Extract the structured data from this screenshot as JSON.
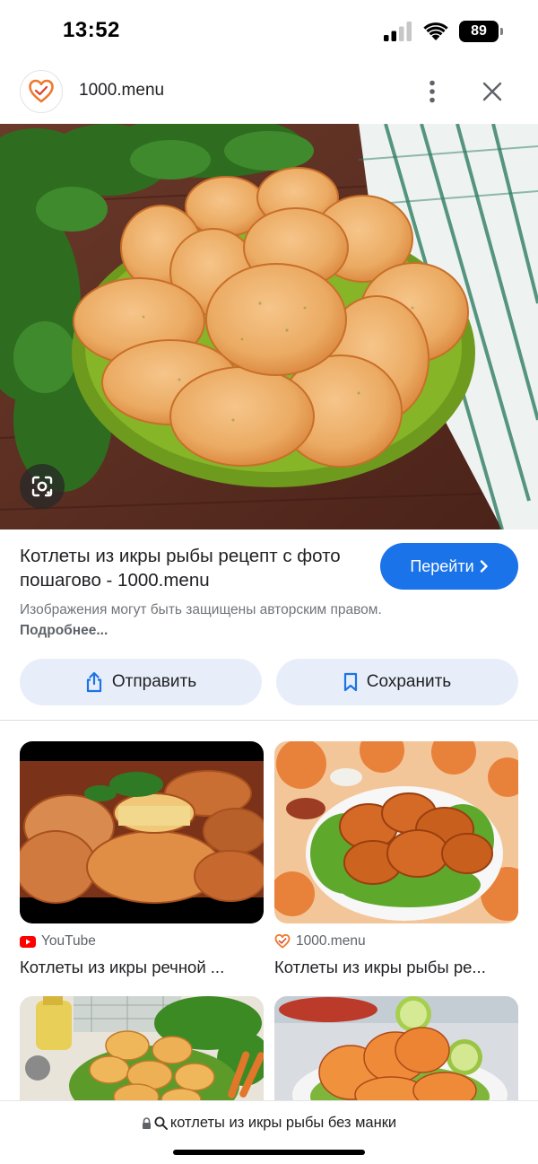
{
  "status_bar": {
    "time": "13:52",
    "battery": "89",
    "icons": [
      "cellular-signal-icon",
      "wifi-icon",
      "battery-icon"
    ]
  },
  "header": {
    "site_name": "1000.menu",
    "icons": [
      "heart-logo-icon",
      "more-vert-icon",
      "close-icon"
    ]
  },
  "hero": {
    "icons": [
      "lens-icon"
    ]
  },
  "result": {
    "title": "Котлеты из икры рыбы рецепт с фото пошагово - 1000.menu",
    "visit_label": "Перейти",
    "copyright_text": "Изображения могут быть защищены авторским правом.",
    "more_link": "Подробнее..."
  },
  "actions": {
    "share_label": "Отправить",
    "save_label": "Сохранить",
    "icons": [
      "share-icon",
      "bookmark-icon"
    ]
  },
  "related": [
    {
      "source": "YouTube",
      "title": "Котлеты из икры речной ...",
      "source_icon": "youtube-icon"
    },
    {
      "source": "1000.menu",
      "title": "Котлеты из икры рыбы ре...",
      "source_icon": "heart-logo-icon"
    },
    {
      "source": "",
      "title": ""
    },
    {
      "source": "",
      "title": ""
    }
  ],
  "bottom_bar": {
    "query": "котлеты из икры рыбы без манки",
    "icons": [
      "lock-icon",
      "search-icon"
    ]
  },
  "colors": {
    "accent_blue": "#1a73e8",
    "tonal_button": "#e8eef9",
    "text_primary": "#202124",
    "text_secondary": "#70757a"
  }
}
